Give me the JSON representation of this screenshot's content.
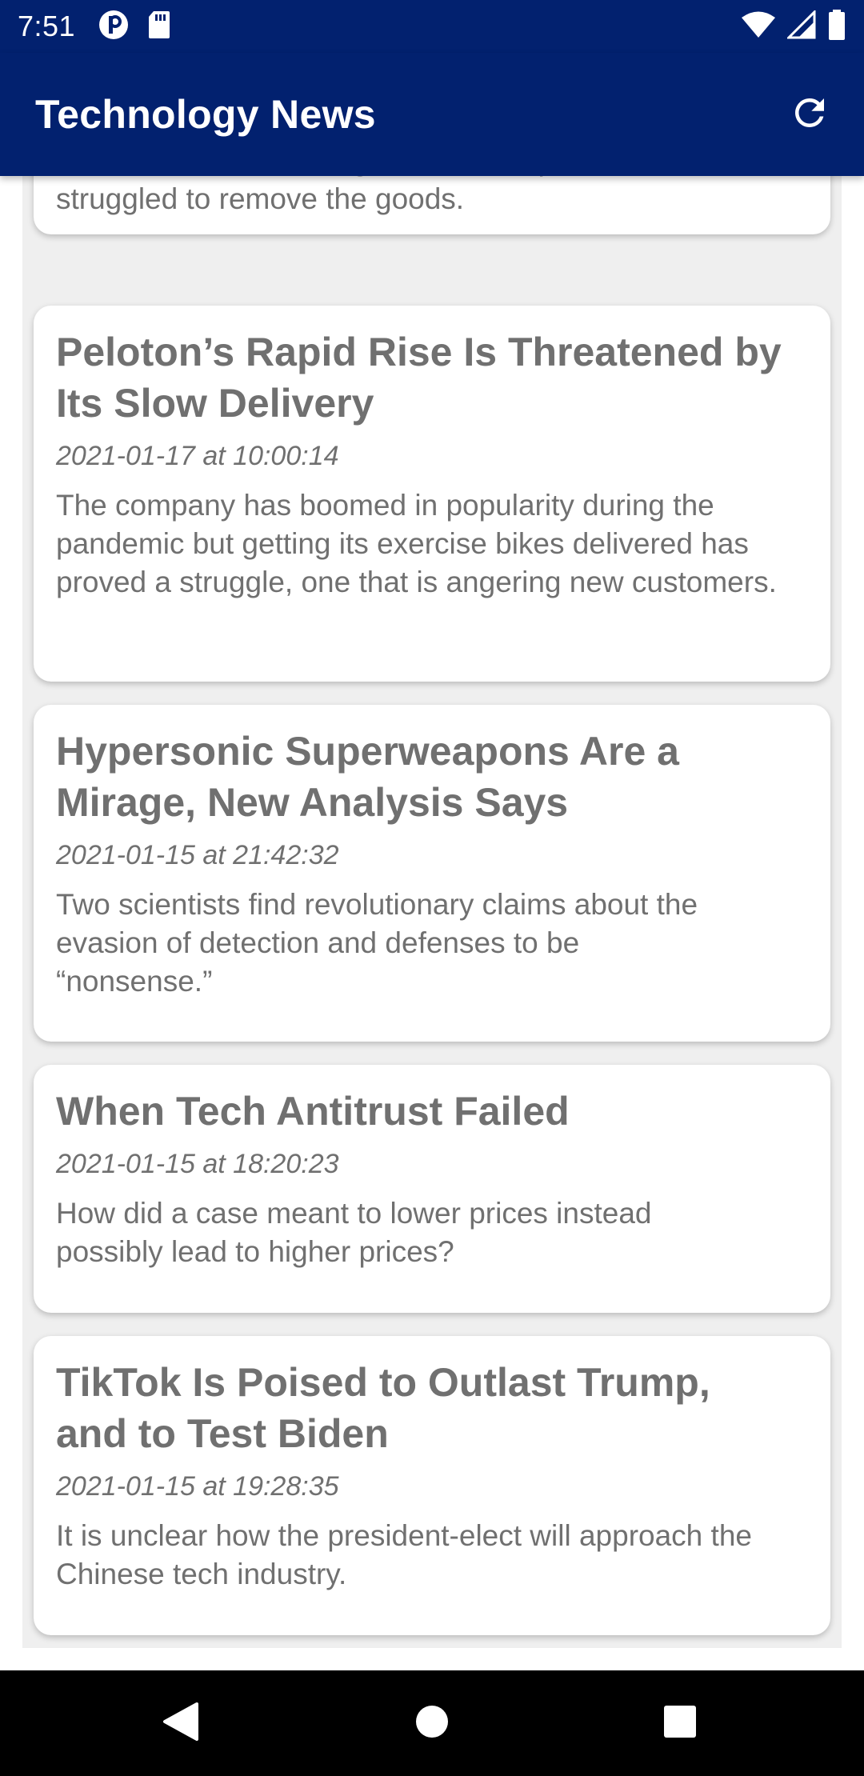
{
  "status_bar": {
    "time": "7:51",
    "left_icons": [
      "notification-p-icon",
      "sd-card-icon"
    ],
    "right_icons": [
      "wifi-icon",
      "signal-icon",
      "battery-icon"
    ]
  },
  "app_bar": {
    "title": "Technology News",
    "action_icon": "refresh-icon",
    "background": "#02216f"
  },
  "articles": [
    {
      "title": "",
      "date": "",
      "description": "e-commerce sites, a sign of how the platforms have struggled to remove the goods."
    },
    {
      "title": "Peloton’s Rapid Rise Is Threatened by Its Slow Delivery",
      "date": "2021-01-17 at 10:00:14",
      "description": "The company has boomed in popularity during the pandemic but getting its exercise bikes delivered has proved a struggle, one that is angering new customers."
    },
    {
      "title": "Hypersonic Superweapons Are a Mirage, New Analysis Says",
      "date": "2021-01-15 at 21:42:32",
      "description": "Two scientists find revolutionary claims about the evasion of detection and defenses to be “nonsense.”"
    },
    {
      "title": "When Tech Antitrust Failed",
      "date": "2021-01-15 at 18:20:23",
      "description": "How did a case meant to lower prices instead possibly lead to higher prices?"
    },
    {
      "title": "TikTok Is Poised to Outlast Trump, and to Test Biden",
      "date": "2021-01-15 at 19:28:35",
      "description": "It is unclear how the president-elect will approach the Chinese tech industry."
    }
  ],
  "nav_bar": {
    "buttons": [
      "back-icon",
      "home-icon",
      "recents-icon"
    ]
  }
}
